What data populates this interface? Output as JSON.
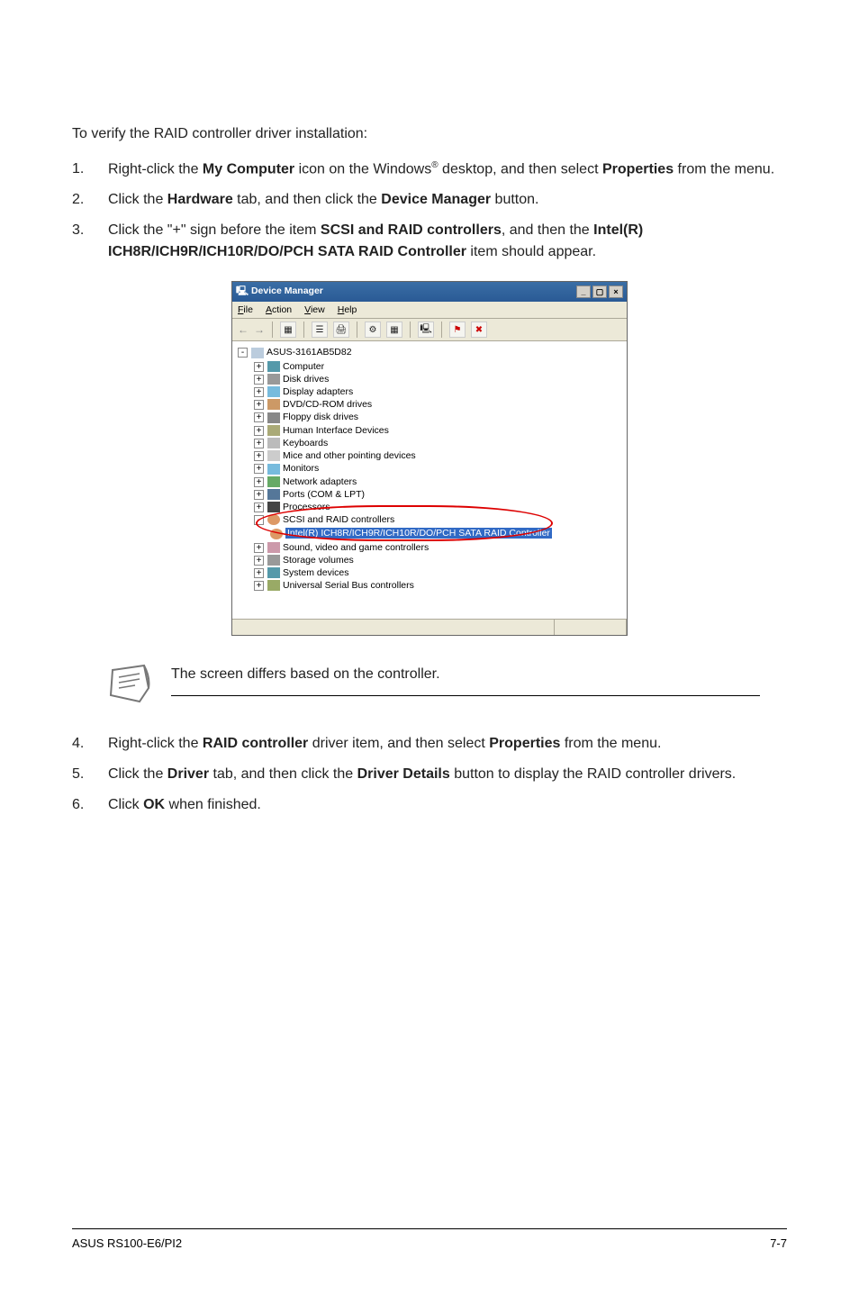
{
  "intro": "To verify the RAID controller driver installation:",
  "steps_top": [
    {
      "num": "1.",
      "pre": "Right-click the ",
      "bold1": "My Computer",
      "mid": " icon on the Windows",
      "sup": "®",
      "post": " desktop, and then select ",
      "bold2": "Properties",
      "tail": " from the menu."
    },
    {
      "num": "2.",
      "pre": "Click the ",
      "bold1": "Hardware",
      "mid": " tab, and then click the ",
      "bold2": "Device Manager",
      "tail": " button."
    },
    {
      "num": "3.",
      "pre": "Click the \"+\" sign before the item ",
      "bold1": "SCSI and RAID controllers",
      "mid": ", and then the ",
      "bold2": "Intel(R) ICH8R/ICH9R/ICH10R/DO/PCH SATA RAID Controller",
      "tail": " item should appear."
    }
  ],
  "devmgr": {
    "title": "Device Manager",
    "menu": {
      "file": "File",
      "action": "Action",
      "view": "View",
      "help": "Help"
    },
    "root": "ASUS-3161AB5D82",
    "nodes": {
      "computer": "Computer",
      "disk": "Disk drives",
      "display": "Display adapters",
      "dvd": "DVD/CD-ROM drives",
      "floppy": "Floppy disk drives",
      "hid": "Human Interface Devices",
      "keyboards": "Keyboards",
      "mice": "Mice and other pointing devices",
      "monitors": "Monitors",
      "network": "Network adapters",
      "ports": "Ports (COM & LPT)",
      "processors": "Processors",
      "scsi": "SCSI and RAID controllers",
      "raid_item": "Intel(R) ICH8R/ICH9R/ICH10R/DO/PCH SATA RAID Controller",
      "sound": "Sound, video and game controllers",
      "storage": "Storage volumes",
      "system": "System devices",
      "usb": "Universal Serial Bus controllers"
    }
  },
  "note": "The screen differs based on the controller.",
  "steps_bottom": [
    {
      "num": "4.",
      "pre": "Right-click the ",
      "bold1": "RAID controller",
      "mid": " driver item, and then select ",
      "bold2": "Properties",
      "tail": " from the menu."
    },
    {
      "num": "5.",
      "pre": "Click the ",
      "bold1": "Driver",
      "mid": " tab, and then click the ",
      "bold2": "Driver Details",
      "tail": " button to display the RAID controller drivers."
    },
    {
      "num": "6.",
      "pre": "Click ",
      "bold1": "OK",
      "mid": " when finished.",
      "bold2": "",
      "tail": ""
    }
  ],
  "footer": {
    "left": "ASUS RS100-E6/PI2",
    "right": "7-7"
  }
}
